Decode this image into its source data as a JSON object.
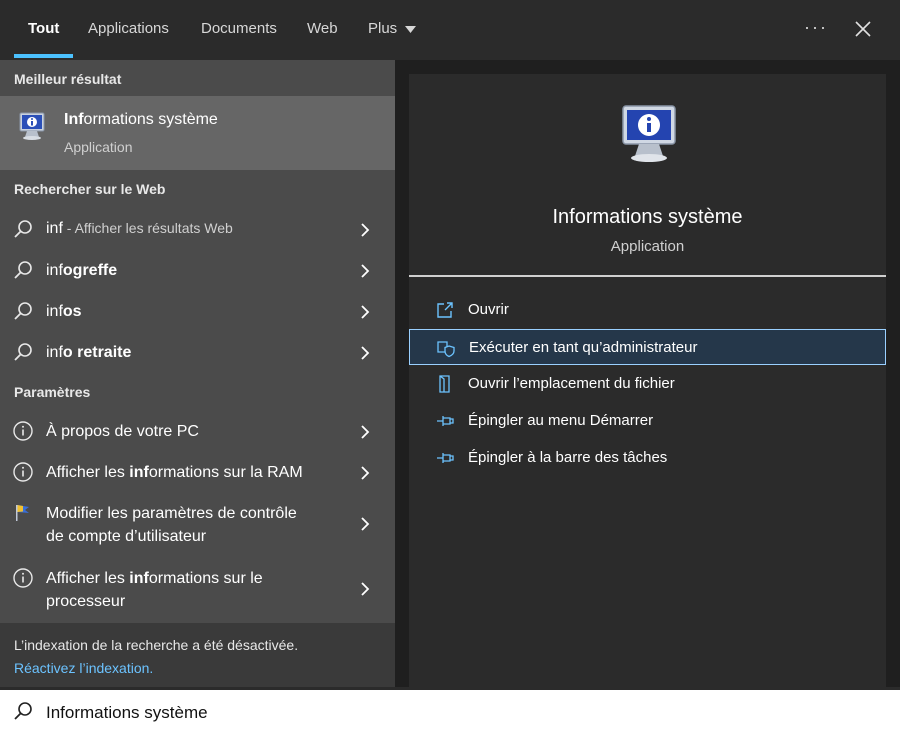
{
  "tabs": [
    {
      "label": "Tout"
    },
    {
      "label": "Applications"
    },
    {
      "label": "Documents"
    },
    {
      "label": "Web"
    },
    {
      "label": "Plus"
    }
  ],
  "window_controls": {
    "more_label": "···"
  },
  "left": {
    "best_match_header": "Meilleur résultat",
    "best_match": {
      "title_bold": "Inf",
      "title_rest": "ormations système",
      "subtitle": "Application",
      "icon": "system-info-icon"
    },
    "web_header": "Rechercher sur le Web",
    "web_items": [
      {
        "pre": "inf",
        "suffix": " - Afficher les résultats Web"
      },
      {
        "pre": "inf",
        "bold": "ogreffe"
      },
      {
        "pre": "inf",
        "bold": "os"
      },
      {
        "pre": "inf",
        "bold": "o retraite"
      }
    ],
    "settings_header": "Paramètres",
    "settings_items": [
      {
        "line1": "À propos de votre PC"
      },
      {
        "pre": "Afficher les ",
        "bold": "inf",
        "post": "ormations sur la RAM"
      },
      {
        "line1": "Modifier les paramètres de contrôle",
        "line2": "de compte d’utilisateur"
      },
      {
        "pre": "Afficher les ",
        "bold": "inf",
        "post": "ormations sur le",
        "line2": "processeur"
      }
    ],
    "footer_note": "L’indexation de la recherche a été désactivée.",
    "footer_link": "Réactivez l’indexation."
  },
  "right": {
    "app_title": "Informations système",
    "app_subtitle": "Application",
    "actions": [
      {
        "label": "Ouvrir",
        "icon": "open-icon"
      },
      {
        "label": "Exécuter en tant qu’administrateur",
        "icon": "shield-icon",
        "selected": true
      },
      {
        "label": "Ouvrir l’emplacement du fichier",
        "icon": "file-location-icon"
      },
      {
        "label": "Épingler au menu Démarrer",
        "icon": "pin-icon"
      },
      {
        "label": "Épingler à la barre des tâches",
        "icon": "pin-icon"
      }
    ]
  },
  "search": {
    "value": "Informations système"
  },
  "colors": {
    "accent": "#4cc2ff",
    "link": "#6cc3ff",
    "selection_border": "#9ad0ff"
  }
}
